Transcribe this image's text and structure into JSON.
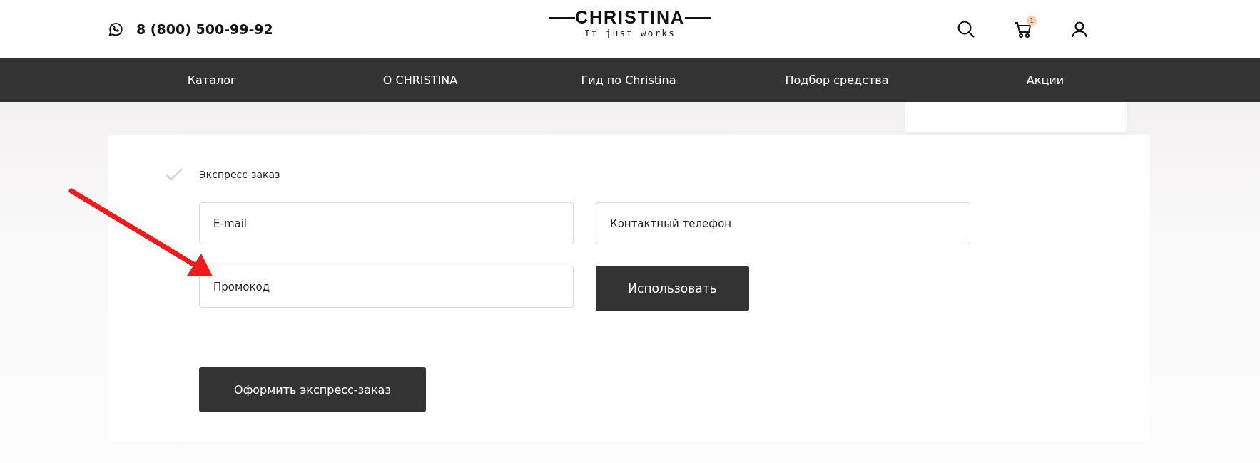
{
  "header": {
    "phone": "8 (800) 500-99-92",
    "logo": {
      "name": "CHRISTINA",
      "tagline": "It just works"
    },
    "cart_count": "1"
  },
  "nav": [
    "Каталог",
    "О CHRISTINA",
    "Гид по Christina",
    "Подбор средства",
    "Акции"
  ],
  "form": {
    "option": "Экспресс-заказ",
    "fields": [
      {
        "placeholder": "E-mail"
      },
      {
        "placeholder": "Контактный телефон"
      }
    ],
    "promo": {
      "placeholder": "Промокод",
      "button": "Использовать"
    },
    "submit": "Оформить экспресс-заказ"
  }
}
